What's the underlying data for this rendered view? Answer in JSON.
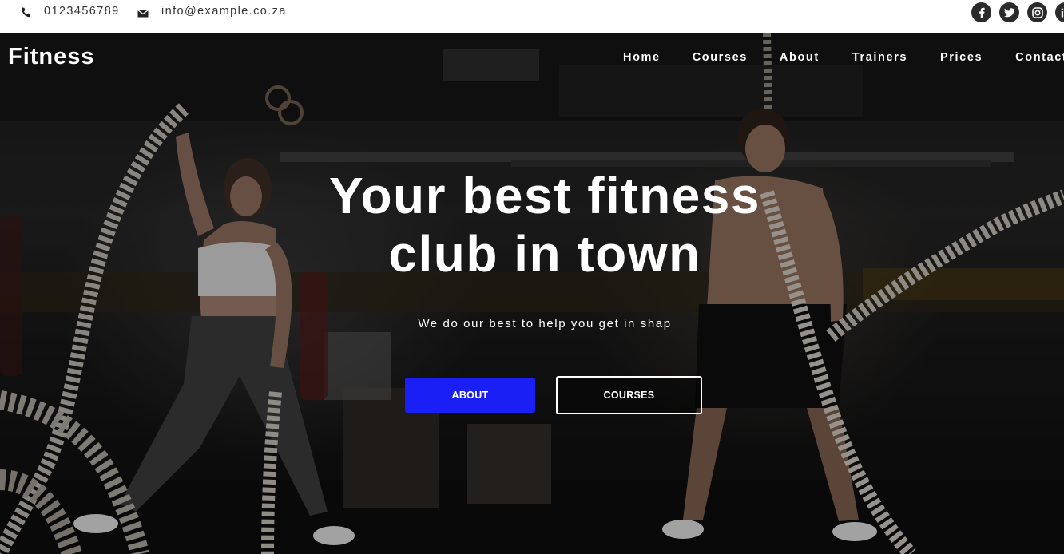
{
  "topbar": {
    "phone": {
      "icon": "phone-icon",
      "text": "0123456789"
    },
    "email": {
      "icon": "mail-icon",
      "text": "info@example.co.za"
    },
    "social": [
      {
        "icon": "facebook-icon"
      },
      {
        "icon": "twitter-icon"
      },
      {
        "icon": "instagram-icon"
      },
      {
        "icon": "linkedin-icon"
      }
    ]
  },
  "header": {
    "brand": "Fitness",
    "nav": [
      "Home",
      "Courses",
      "About",
      "Trainers",
      "Prices",
      "Contact"
    ]
  },
  "hero": {
    "title_line1": "Your best fitness",
    "title_line2": "club in town",
    "subtitle": "We do our best to help you get in shap",
    "buttons": {
      "about": "ABOUT",
      "courses": "COURSES"
    }
  },
  "colors": {
    "primary_button": "#1a1ff5",
    "topbar_bg": "#ffffff",
    "social_icon_bg": "#2b2b2b",
    "text_on_hero": "#ffffff"
  }
}
